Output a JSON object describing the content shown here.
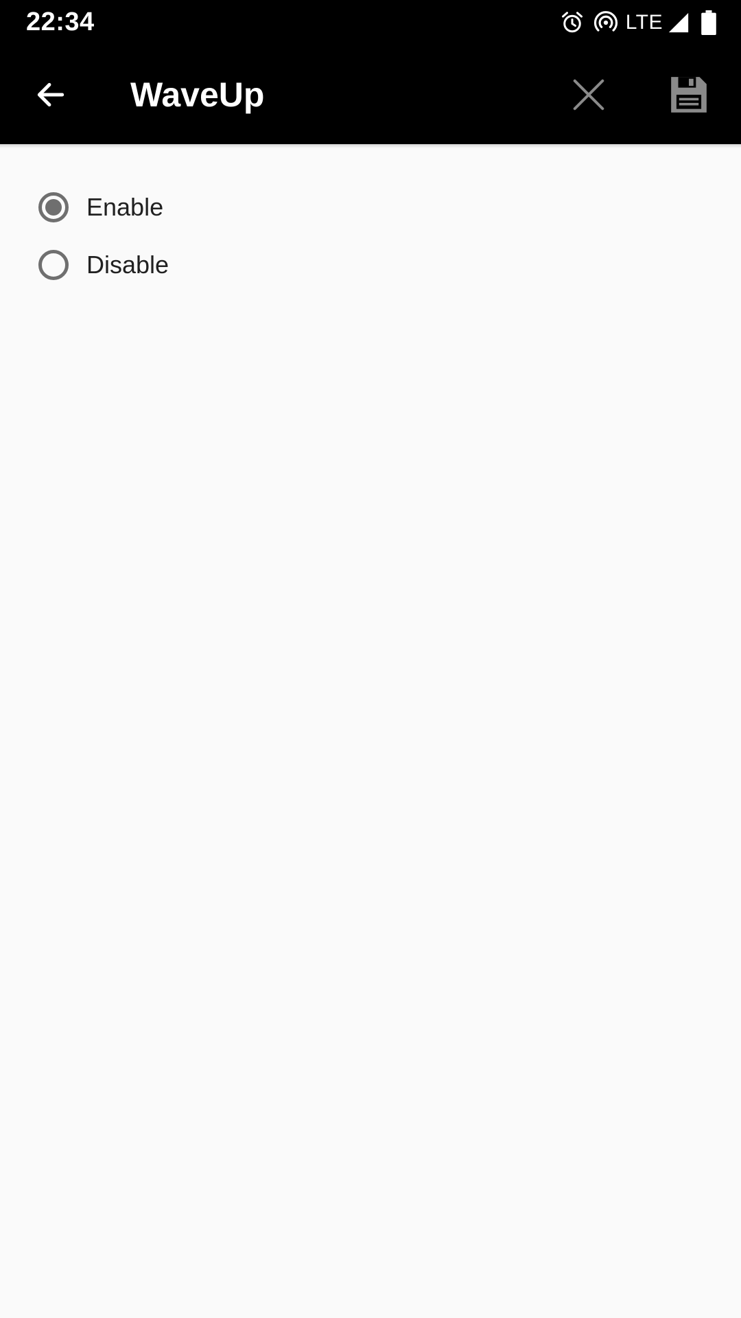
{
  "status_bar": {
    "time": "22:34",
    "network": "LTE",
    "icons": [
      "alarm-icon",
      "hotspot-icon",
      "signal-icon",
      "battery-icon"
    ]
  },
  "app_bar": {
    "title": "WaveUp",
    "back_icon": "arrow-left-icon",
    "close_icon": "close-icon",
    "save_icon": "floppy-save-icon"
  },
  "radio_options": [
    {
      "label": "Enable",
      "selected": true
    },
    {
      "label": "Disable",
      "selected": false
    }
  ],
  "colors": {
    "bar_background": "#000000",
    "page_background": "#fafafa",
    "radio_color": "#6f6f6f",
    "icon_grey": "#8a8a8a",
    "text_primary": "#212121"
  }
}
